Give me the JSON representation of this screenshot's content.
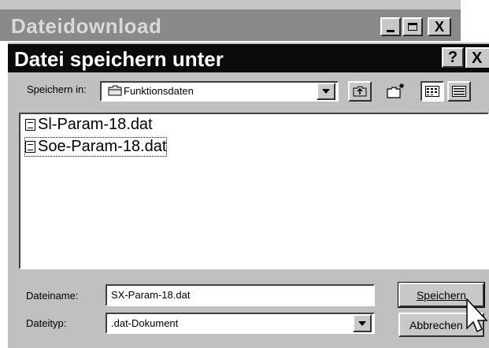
{
  "background_window": {
    "title": "Dateidownload",
    "buttons": [
      "_",
      "□",
      "X"
    ]
  },
  "dialog": {
    "title": "Datei speichern unter",
    "help_label": "?",
    "close_label": "X",
    "save_in": {
      "label": "Speichern in:",
      "value": "Funktionsdaten"
    },
    "files": [
      {
        "name": "Sl-Param-18.dat",
        "selected": false
      },
      {
        "name": "Soe-Param-18.dat",
        "selected": true
      }
    ],
    "filename": {
      "label": "Dateiname:",
      "value": "SX-Param-18.dat"
    },
    "filetype": {
      "label": "Dateityp:",
      "value": ".dat-Dokument"
    },
    "buttons": {
      "save": "Speichern",
      "cancel": "Abbrechen"
    }
  }
}
